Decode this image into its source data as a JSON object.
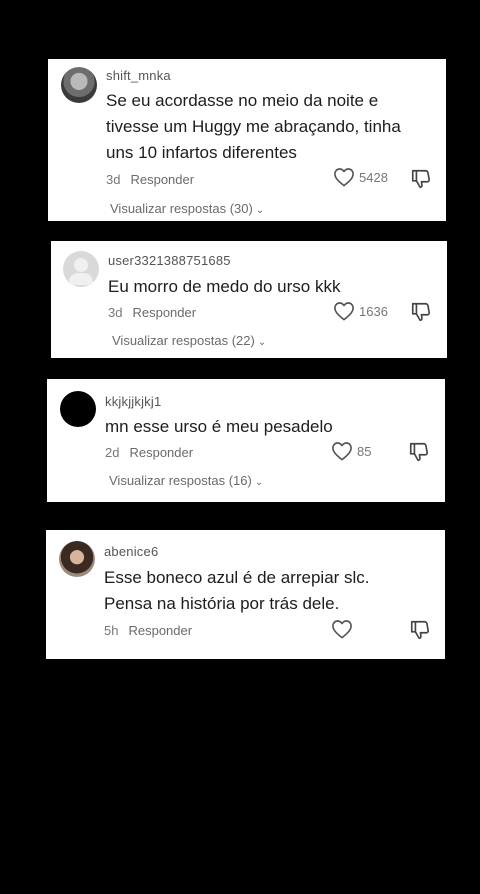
{
  "comments": [
    {
      "username": "shift_mnka",
      "text_lines": [
        "Se eu acordasse no meio da noite e",
        "tivesse um Huggy me abraçando, tinha",
        "uns 10 infartos diferentes"
      ],
      "age": "3d",
      "reply_label": "Responder",
      "likes": "5428",
      "replies_label": "Visualizar respostas (30)"
    },
    {
      "username": "user3321388751685",
      "text_lines": [
        "Eu morro de medo do urso kkk"
      ],
      "age": "3d",
      "reply_label": "Responder",
      "likes": "1636",
      "replies_label": "Visualizar respostas (22)"
    },
    {
      "username": "kkjkjjkjkj1",
      "text_lines": [
        "mn esse urso é meu pesadelo"
      ],
      "age": "2d",
      "reply_label": "Responder",
      "likes": "85",
      "replies_label": "Visualizar respostas (16)"
    },
    {
      "username": "abenice6",
      "text_lines": [
        "Esse boneco azul é de arrepiar slc.",
        "Pensa na história por trás dele."
      ],
      "age": "5h",
      "reply_label": "Responder",
      "likes": "",
      "replies_label": ""
    }
  ],
  "icons": {
    "like": "heart-outline-icon",
    "dislike": "thumbs-down-icon",
    "chevron": "chevron-down-icon"
  }
}
